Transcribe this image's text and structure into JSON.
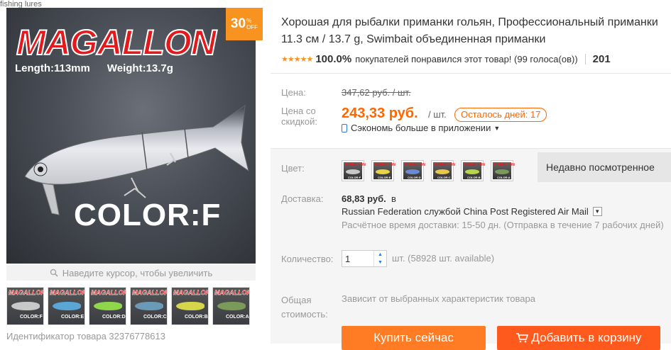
{
  "breadcrumb": "fishing lures",
  "gallery": {
    "brand": "MAGALLON",
    "length": "Length:113mm",
    "weight": "Weight:13.7g",
    "color_label": "COLOR:F",
    "discount_pct": "30",
    "discount_sym": "%",
    "discount_off": "OFF",
    "zoom_hint": "Наведите курсор, чтобы увеличить",
    "thumbnails": [
      {
        "brand": "MAGALLON",
        "color": "COLOR:F",
        "fish_color": "#c8c8c8"
      },
      {
        "brand": "MAGALLON",
        "color": "COLOR:E",
        "fish_color": "#5aa6d6"
      },
      {
        "brand": "MAGALLON",
        "color": "COLOR:D",
        "fish_color": "#8fd64a"
      },
      {
        "brand": "MAGALLON",
        "color": "COLOR:C",
        "fish_color": "#6b9ab8"
      },
      {
        "brand": "MAGALLON",
        "color": "COLOR:B",
        "fish_color": "#d6d64a"
      },
      {
        "brand": "MAGALLON",
        "color": "COLOR:A",
        "fish_color": "#7a9a5a"
      }
    ],
    "product_id": "Идентификатор товара 32376778613"
  },
  "product": {
    "title": "Хорошая для рыбалки приманки гольян, Профессиональный приманки 11.3 см / 13.7 g, Swimbait объединенная приманки",
    "stars": "★★★★★",
    "rating_pct": "100.0%",
    "rating_text": "покупателей понравился этот товар! (99 голоса(ов))",
    "orders": "201"
  },
  "price": {
    "label": "Цена:",
    "old": "347,62 руб. / шт.",
    "discount_label": "Цена со скидкой:",
    "new": "243,33 руб.",
    "per_unit": "/ шт.",
    "days_left": "Осталось дней: 17",
    "app_save": "Сэкономь больше в приложении",
    "app_caret": "▼"
  },
  "options": {
    "color_label": "Цвет:",
    "swatches": [
      {
        "label": "COLOR:F",
        "fish_color": "#c8c8c8"
      },
      {
        "label": "COLOR:E",
        "fish_color": "#e8d24a"
      },
      {
        "label": "COLOR:D",
        "fish_color": "#6a8ad6"
      },
      {
        "label": "COLOR:C",
        "fish_color": "#e8c84a"
      },
      {
        "label": "COLOR:B",
        "fish_color": "#b8d64a"
      },
      {
        "label": "COLOR:A",
        "fish_color": "#7a9a5a"
      }
    ],
    "recently_viewed": "Недавно посмотренное"
  },
  "shipping": {
    "label": "Доставка:",
    "cost": "68,83 руб.",
    "to": "в",
    "service": "Russian Federation службой China Post Registered Air Mail",
    "time": "Расчётное время доставки: 15-50 дн. (Отправка в течение 7 рабочих дней)"
  },
  "quantity": {
    "label": "Количество:",
    "value": "1",
    "available": "шт. (58928 шт. available)"
  },
  "total": {
    "label": "Общая стоимость:",
    "value": "Зависит от выбранных характеристик товара"
  },
  "actions": {
    "buy_now": "Купить сейчас",
    "add_to_cart": "Добавить в корзину"
  },
  "colors": {
    "accent": "#f60",
    "button_buy": "#ff7b24",
    "button_cart": "#ff5a1e",
    "brand_red": "#e3191b"
  }
}
